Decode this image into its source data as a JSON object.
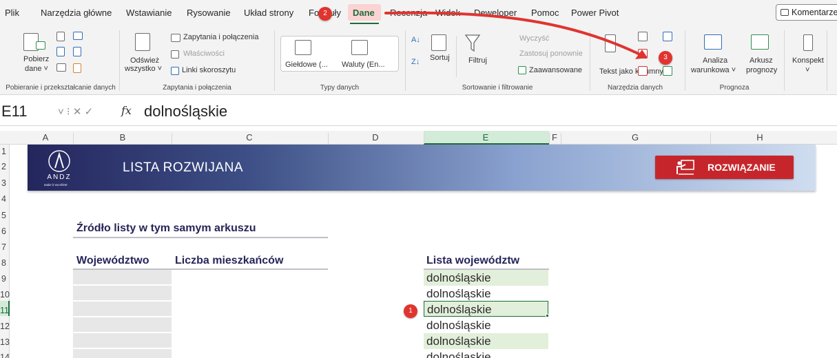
{
  "tabs": [
    "Plik",
    "Narzędzia główne",
    "Wstawianie",
    "Rysowanie",
    "Układ strony",
    "Formuły",
    "Dane",
    "Recenzja",
    "Widok",
    "Deweloper",
    "Pomoc",
    "Power Pivot"
  ],
  "active_tab": "Dane",
  "komentarze_label": "Komentarze",
  "ribbon": {
    "groups": [
      {
        "label": "Pobieranie i przekształcanie danych",
        "buttons": [
          "Pobierz",
          "dane ˅"
        ]
      },
      {
        "label": "Zapytania i połączenia",
        "buttons": [
          "Odśwież",
          "wszystko ˅",
          "Zapytania i połączenia",
          "Właściwości",
          "Linki skoroszytu"
        ]
      },
      {
        "label": "Typy danych",
        "buttons": [
          "Giełdowe (...",
          "Waluty (En..."
        ]
      },
      {
        "label": "Sortowanie i filtrowanie",
        "buttons": [
          "Sortuj",
          "Filtruj",
          "Wyczyść",
          "Zastosuj ponownie",
          "Zaawansowane"
        ]
      },
      {
        "label": "Narzędzia danych",
        "buttons": [
          "Tekst jako kolumny"
        ]
      },
      {
        "label": "Prognoza",
        "buttons": [
          "Analiza",
          "warunkowa ˅",
          "Arkusz",
          "prognozy"
        ]
      },
      {
        "label": "",
        "buttons": [
          "Konspekt",
          "˅"
        ]
      }
    ]
  },
  "formula_bar": {
    "name_box": "E11",
    "icons": "˅ ⁝ ✕ ✓",
    "fx": "fx",
    "formula": "dolnośląskie"
  },
  "columns": [
    "A",
    "B",
    "C",
    "D",
    "E",
    "F",
    "G",
    "H"
  ],
  "selected_column": "E",
  "rows": [
    "1",
    "2",
    "3",
    "4",
    "5",
    "6",
    "7",
    "8",
    "9",
    "10",
    "11",
    "12",
    "13",
    "14"
  ],
  "selected_row": "11",
  "banner": {
    "logo_text": "ANDZ",
    "logo_tagline": "make it excellent",
    "title": "LISTA ROZWIJANA",
    "solution_button": "ROZWIĄZANIE"
  },
  "content": {
    "source_heading": "Źródło listy w tym samym arkuszu",
    "col_headers": [
      "Województwo",
      "Liczba mieszkańców"
    ],
    "list_header": "Lista województw",
    "list_items": [
      "dolnośląskie",
      "dolnośląskie",
      "dolnośląskie",
      "dolnośląskie",
      "dolnośląskie",
      "dolnośląskie"
    ]
  },
  "callouts": [
    "1",
    "2",
    "3"
  ],
  "colors": {
    "accent": "#1e6b3c",
    "callout": "#e0342f",
    "banner_dark": "#24265d",
    "solution_button": "#c6262b"
  }
}
